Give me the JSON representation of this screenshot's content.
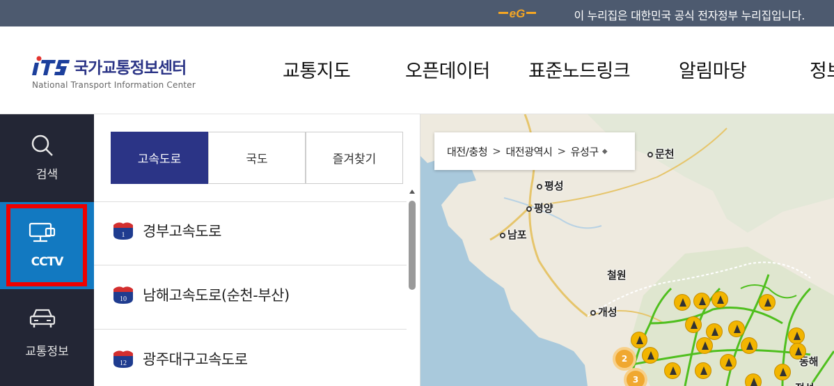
{
  "gov_banner": {
    "text": "이 누리집은 대한민국 공식 전자정부 누리집입니다."
  },
  "logo": {
    "title": "국가교통정보센터",
    "subtitle": "National Transport Information Center"
  },
  "nav": [
    {
      "label": "교통지도"
    },
    {
      "label": "오픈데이터"
    },
    {
      "label": "표준노드링크"
    },
    {
      "label": "알림마당"
    },
    {
      "label": "정보"
    }
  ],
  "sidebar": {
    "items": [
      {
        "label": "검색",
        "icon": "search-icon"
      },
      {
        "label": "CCTV",
        "icon": "cctv-icon",
        "active": true
      },
      {
        "label": "교통정보",
        "icon": "car-icon"
      }
    ]
  },
  "tabs": [
    {
      "label": "고속도로",
      "active": true
    },
    {
      "label": "국도"
    },
    {
      "label": "즐겨찾기"
    }
  ],
  "roads": [
    {
      "number": "1",
      "name": "경부고속도로"
    },
    {
      "number": "10",
      "name": "남해고속도로(순천-부산)"
    },
    {
      "number": "12",
      "name": "광주대구고속도로"
    }
  ],
  "breadcrumb": {
    "level1": "대전/충청",
    "level2": "대전광역시",
    "level3": "유성구"
  },
  "map": {
    "cities": [
      {
        "name": "평성"
      },
      {
        "name": "평양"
      },
      {
        "name": "남포"
      },
      {
        "name": "철원"
      },
      {
        "name": "개성"
      },
      {
        "name": "문천"
      },
      {
        "name": "정선"
      },
      {
        "name": "동해"
      }
    ],
    "clusters": [
      "2",
      "3"
    ]
  },
  "colors": {
    "brand": "#2b3486",
    "active_side": "#1279c1",
    "highlight": "#ee0000",
    "topbar": "#4d5a6f"
  }
}
